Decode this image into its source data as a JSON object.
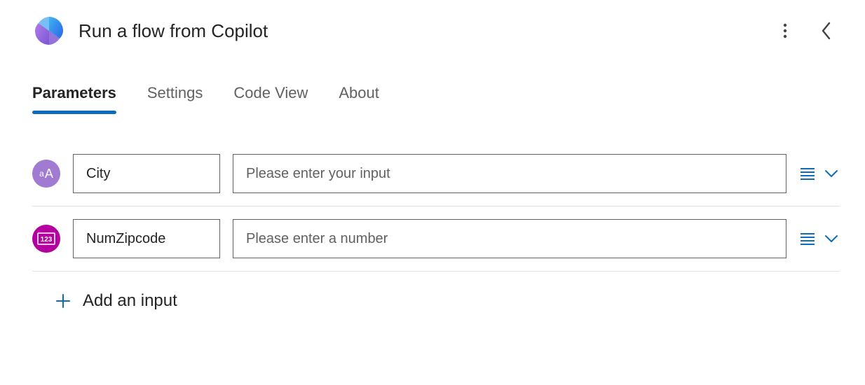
{
  "header": {
    "title": "Run a flow from Copilot"
  },
  "tabs": [
    {
      "label": "Parameters",
      "active": true
    },
    {
      "label": "Settings",
      "active": false
    },
    {
      "label": "Code View",
      "active": false
    },
    {
      "label": "About",
      "active": false
    }
  ],
  "parameters": [
    {
      "type": "text",
      "type_glyph": "aA",
      "name": "City",
      "value": "",
      "placeholder": "Please enter your input"
    },
    {
      "type": "number",
      "type_glyph": "123",
      "name": "NumZipcode",
      "value": "",
      "placeholder": "Please enter a number"
    }
  ],
  "add_input_label": "Add an input"
}
